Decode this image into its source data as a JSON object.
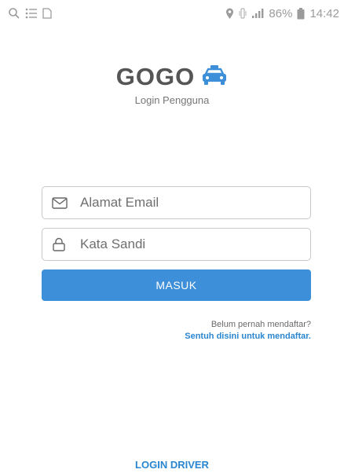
{
  "status_bar": {
    "battery": "86%",
    "time": "14:42"
  },
  "brand": {
    "title": "GOGO",
    "subtitle": "Login Pengguna",
    "icon": "taxi-icon"
  },
  "form": {
    "email": {
      "placeholder": "Alamat Email",
      "value": "",
      "icon": "envelope-icon"
    },
    "password": {
      "placeholder": "Kata Sandi",
      "value": "",
      "icon": "lock-icon"
    },
    "submit_label": "MASUK"
  },
  "register": {
    "question": "Belum pernah mendaftar?",
    "link": "Sentuh disini untuk mendaftar."
  },
  "driver_link": "LOGIN DRIVER",
  "colors": {
    "accent": "#3d8fd9",
    "link": "#2a86d0",
    "brand_text": "#555555"
  }
}
